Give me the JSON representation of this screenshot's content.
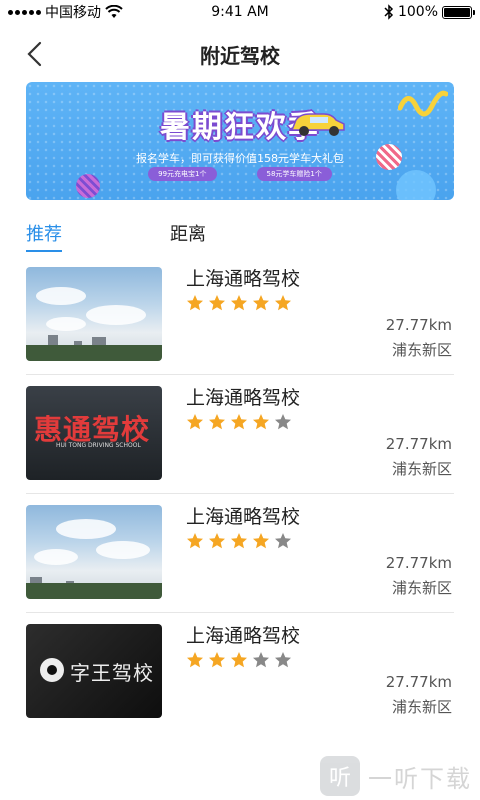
{
  "status_bar": {
    "carrier": "中国移动",
    "time": "9:41 AM",
    "battery": "100%"
  },
  "nav": {
    "title": "附近驾校"
  },
  "banner": {
    "headline": "暑期狂欢季",
    "subtitle": "报名学车，即可获得价值158元学车大礼包",
    "pill_left": "99元充电宝1个",
    "pill_right": "58元学车赠险1个"
  },
  "tabs": [
    {
      "label": "推荐",
      "active": true
    },
    {
      "label": "距离",
      "active": false
    }
  ],
  "schools": [
    {
      "name": "上海通略驾校",
      "rating": 5,
      "distance": "27.77km",
      "district": "浦东新区",
      "thumb": "sky"
    },
    {
      "name": "上海通略驾校",
      "rating": 4,
      "distance": "27.77km",
      "district": "浦东新区",
      "thumb": "huitong",
      "logo_text": "惠通驾校",
      "logo_sub": "HUI TONG DRIVING SCHOOL"
    },
    {
      "name": "上海通略驾校",
      "rating": 4,
      "distance": "27.77km",
      "district": "浦东新区",
      "thumb": "sky"
    },
    {
      "name": "上海通略驾校",
      "rating": 3,
      "distance": "27.77km",
      "district": "浦东新区",
      "thumb": "black",
      "logo_text": "字王驾校"
    }
  ],
  "colors": {
    "accent": "#2a8fe8",
    "star_on": "#f5a623",
    "star_off": "#888888"
  },
  "watermark": {
    "icon": "听",
    "text": "一听下载"
  }
}
